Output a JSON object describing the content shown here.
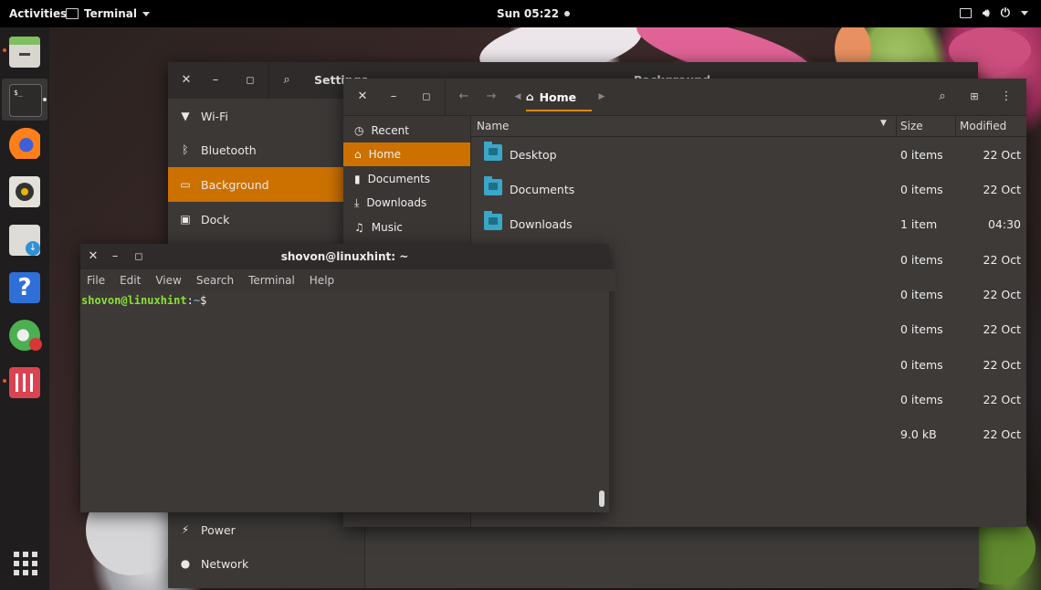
{
  "topbar": {
    "activities": "Activities",
    "app_name": "Terminal",
    "clock": "Sun 05:22"
  },
  "dock": {
    "apps": [
      "files-app",
      "terminal-app",
      "firefox-app",
      "rhythmbox-app",
      "software-app",
      "help-app",
      "gimp-app",
      "mixer-app"
    ],
    "show_apps": "show-applications"
  },
  "settings": {
    "title": "Settings",
    "right_title": "Background",
    "items": [
      {
        "label": "Wi-Fi",
        "icon": "wifi-icon"
      },
      {
        "label": "Bluetooth",
        "icon": "bluetooth-icon"
      },
      {
        "label": "Background",
        "icon": "background-icon",
        "selected": true
      },
      {
        "label": "Dock",
        "icon": "dock-icon"
      },
      {
        "label": "Power",
        "icon": "power-icon"
      },
      {
        "label": "Network",
        "icon": "network-icon"
      }
    ]
  },
  "files": {
    "location": "Home",
    "places": [
      {
        "label": "Recent",
        "icon": "recent-icon"
      },
      {
        "label": "Home",
        "icon": "home-icon",
        "selected": true
      },
      {
        "label": "Documents",
        "icon": "document-icon"
      },
      {
        "label": "Downloads",
        "icon": "download-icon"
      },
      {
        "label": "Music",
        "icon": "music-icon"
      }
    ],
    "columns": {
      "name": "Name",
      "size": "Size",
      "modified": "Modified"
    },
    "rows": [
      {
        "name": "Desktop",
        "size": "0 items",
        "modified": "22 Oct"
      },
      {
        "name": "Documents",
        "size": "0 items",
        "modified": "22 Oct"
      },
      {
        "name": "Downloads",
        "size": "1 item",
        "modified": "04:30"
      },
      {
        "name": "",
        "size": "0 items",
        "modified": "22 Oct"
      },
      {
        "name": "",
        "size": "0 items",
        "modified": "22 Oct"
      },
      {
        "name": "",
        "size": "0 items",
        "modified": "22 Oct"
      },
      {
        "name": "",
        "size": "0 items",
        "modified": "22 Oct"
      },
      {
        "name": "",
        "size": "0 items",
        "modified": "22 Oct"
      },
      {
        "name": "",
        "size": "9.0 kB",
        "modified": "22 Oct"
      }
    ]
  },
  "terminal": {
    "title": "shovon@linuxhint: ~",
    "menu": [
      "File",
      "Edit",
      "View",
      "Search",
      "Terminal",
      "Help"
    ],
    "prompt_user": "shovon@linuxhint",
    "prompt_sep": ":",
    "prompt_path": "~",
    "prompt_symbol": "$"
  },
  "colors": {
    "accent": "#cc7100",
    "folder": "#3aa7c8",
    "prompt_user": "#8ae234",
    "prompt_path": "#729fcf"
  }
}
